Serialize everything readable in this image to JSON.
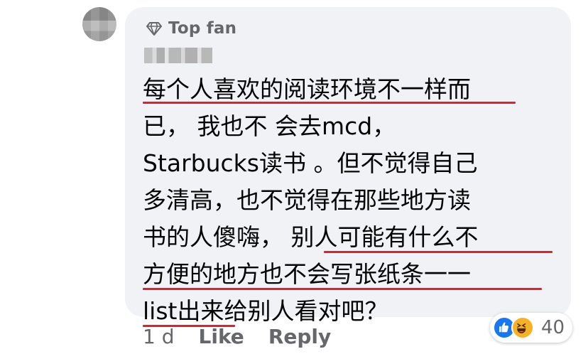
{
  "badge": {
    "label": "Top fan",
    "icon": "diamond-icon"
  },
  "comment": {
    "lines": [
      "每个人喜欢的阅读环境不一样而",
      "已， 我也不 会去mcd，",
      "Starbucks读书 。但不觉得自己",
      "多清高，也不觉得在那些地方读",
      "书的人傻嗨， 别人可能有什么不",
      "方便的地方也不会写张纸条一一",
      "list出来给别人看对吧？"
    ]
  },
  "meta": {
    "time": "1 d",
    "like_label": "Like",
    "reply_label": "Reply"
  },
  "reactions": {
    "count": "40",
    "types": [
      "like-icon",
      "haha-icon"
    ]
  },
  "colors": {
    "bubble": "#f0f2f5",
    "underline": "#e41e2b",
    "secondary_text": "#65676b",
    "like_blue": "#1877f2",
    "haha_yellow": "#f7b125"
  }
}
